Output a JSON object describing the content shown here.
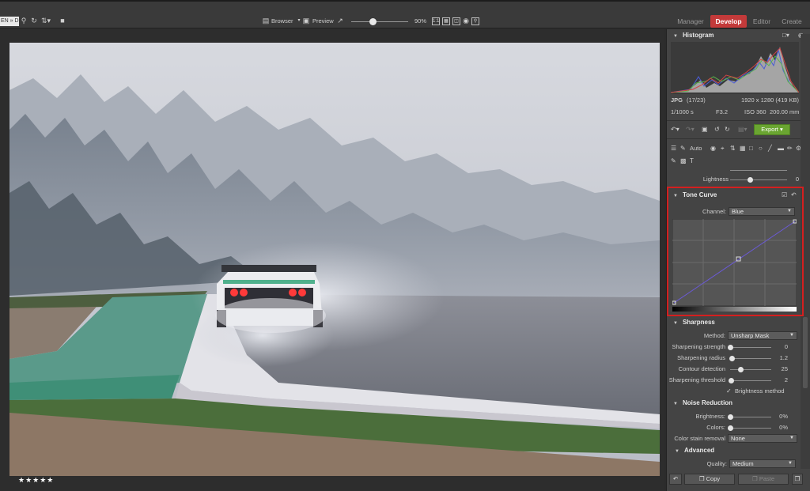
{
  "toolbar": {
    "path_text": "EN » DI",
    "browser_label": "Browser",
    "preview_label": "Preview",
    "zoom_text": "90%",
    "modes": [
      "Manager",
      "Develop",
      "Editor",
      "Create"
    ],
    "active_mode": "Develop"
  },
  "photo": {
    "rating": "★★★★★"
  },
  "histogram": {
    "title": "Histogram",
    "format": "JPG",
    "index": "(17/23)",
    "dimensions": "1920 x 1280 (419 KB)",
    "shutter": "1/1000 s",
    "aperture": "F3.2",
    "iso": "ISO 360",
    "focal": "200.00 mm"
  },
  "actions": {
    "export_label": "Export",
    "auto_label": "Auto"
  },
  "lightness": {
    "label": "Lightness",
    "value": "0"
  },
  "tone_curve": {
    "title": "Tone Curve",
    "channel_label": "Channel:",
    "channel_value": "Blue"
  },
  "sharpness": {
    "title": "Sharpness",
    "method_label": "Method:",
    "method_value": "Unsharp Mask",
    "rows": [
      {
        "label": "Sharpening strength",
        "value": "0",
        "level": 0.0
      },
      {
        "label": "Sharpening radius",
        "value": "1.2",
        "level": 0.06
      },
      {
        "label": "Contour detection",
        "value": "25",
        "level": 0.25
      },
      {
        "label": "Sharpening threshold",
        "value": "2",
        "level": 0.02
      }
    ],
    "brightness_method_label": "Brightness method",
    "brightness_method_checked": true
  },
  "noise": {
    "title": "Noise Reduction",
    "rows": [
      {
        "label": "Brightness:",
        "value": "0%",
        "level": 0.0
      },
      {
        "label": "Colors:",
        "value": "0%",
        "level": 0.0
      }
    ],
    "stain_label": "Color stain removal",
    "stain_value": "None"
  },
  "advanced": {
    "title": "Advanced",
    "quality_label": "Quality:",
    "quality_value": "Medium"
  },
  "bottom": {
    "copy_label": "Copy",
    "paste_label": "Paste"
  },
  "colors": {
    "accent_red": "#c33a3a",
    "export_green": "#6aa531",
    "highlight_red": "#d41f1f"
  }
}
